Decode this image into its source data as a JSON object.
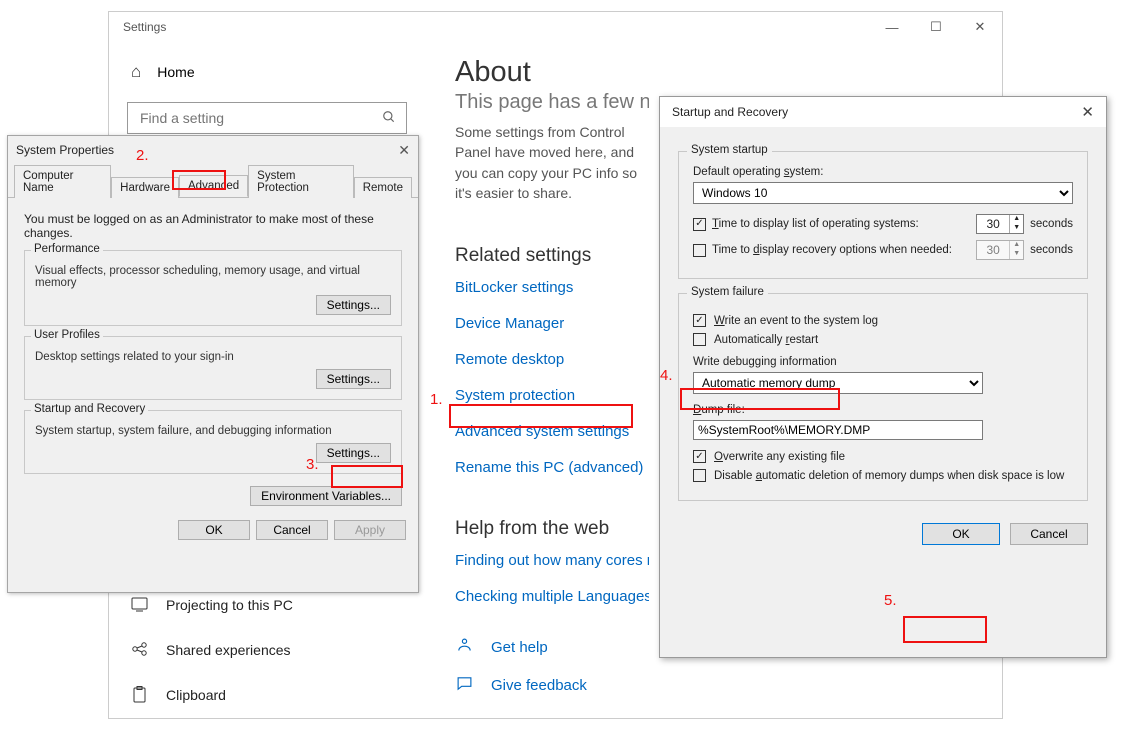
{
  "settings": {
    "window_title": "Settings",
    "home": "Home",
    "search_placeholder": "Find a setting",
    "about_heading": "About",
    "trunc_line": "This page has a few new settings",
    "cp_desc": "Some settings from Control Panel have moved here, and you can copy your PC info so it's easier to share.",
    "related_heading": "Related settings",
    "links": {
      "bitlocker": "BitLocker settings",
      "devmgr": "Device Manager",
      "rdp": "Remote desktop",
      "sysprotect": "System protection",
      "advsys": "Advanced system settings",
      "rename": "Rename this PC (advanced)"
    },
    "help_heading": "Help from the web",
    "help_links": {
      "cores": "Finding out how many cores my processor has",
      "langs": "Checking multiple Languages support"
    },
    "get_help": "Get help",
    "give_feedback": "Give feedback",
    "nav": {
      "projecting": "Projecting to this PC",
      "shared": "Shared experiences",
      "clipboard": "Clipboard"
    }
  },
  "annot": {
    "n1": "1.",
    "n2": "2.",
    "n3": "3.",
    "n4": "4.",
    "n5": "5."
  },
  "sysprop": {
    "title": "System Properties",
    "tabs": {
      "computer_name": "Computer Name",
      "hardware": "Hardware",
      "advanced": "Advanced",
      "sysprotect": "System Protection",
      "remote": "Remote"
    },
    "admin_note": "You must be logged on as an Administrator to make most of these changes.",
    "perf_title": "Performance",
    "perf_desc": "Visual effects, processor scheduling, memory usage, and virtual memory",
    "profiles_title": "User Profiles",
    "profiles_desc": "Desktop settings related to your sign-in",
    "startup_title": "Startup and Recovery",
    "startup_desc": "System startup, system failure, and debugging information",
    "settings_btn": "Settings...",
    "envvars_btn": "Environment Variables...",
    "ok": "OK",
    "cancel": "Cancel",
    "apply": "Apply"
  },
  "startup": {
    "title": "Startup and Recovery",
    "sys_startup": "System startup",
    "default_os_label": "Default operating system:",
    "default_os": "Windows 10",
    "time_list_label": "Time to display list of operating systems:",
    "time_list_val": "30",
    "seconds": "seconds",
    "time_recovery_label": "Time to display recovery options when needed:",
    "time_recovery_val": "30",
    "sys_failure": "System failure",
    "write_event": "Write an event to the system log",
    "auto_restart": "Automatically restart",
    "write_dbg": "Write debugging information",
    "dump_type": "Automatic memory dump",
    "dump_file_label": "Dump file:",
    "dump_file": "%SystemRoot%\\MEMORY.DMP",
    "overwrite": "Overwrite any existing file",
    "disable_del": "Disable automatic deletion of memory dumps when disk space is low",
    "ok": "OK",
    "cancel": "Cancel"
  }
}
